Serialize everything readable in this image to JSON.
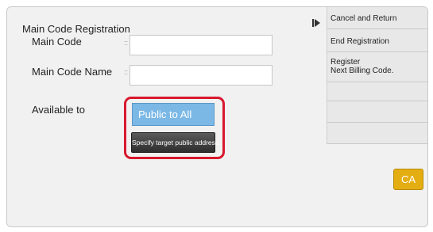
{
  "panel": {
    "title": "Main Code Registration"
  },
  "form": {
    "main_code": {
      "label": "Main Code",
      "value": ""
    },
    "main_code_name": {
      "label": "Main Code Name",
      "value": ""
    },
    "available_to": {
      "label": "Available to"
    },
    "separator": "::"
  },
  "visibility": {
    "selected": "Public to All",
    "target_button": "Specify target public address"
  },
  "side_menu": {
    "items": [
      {
        "label": "Cancel and Return"
      },
      {
        "label": "End Registration"
      },
      {
        "label": "Register\nNext Billing Code."
      }
    ]
  },
  "ca_button": {
    "label": "CA",
    "color": "#e4ad12"
  },
  "colors": {
    "accent": "#7cb8e6",
    "highlight": "#d8182d"
  },
  "icons": {
    "collapse": "collapse-arrow-icon"
  }
}
